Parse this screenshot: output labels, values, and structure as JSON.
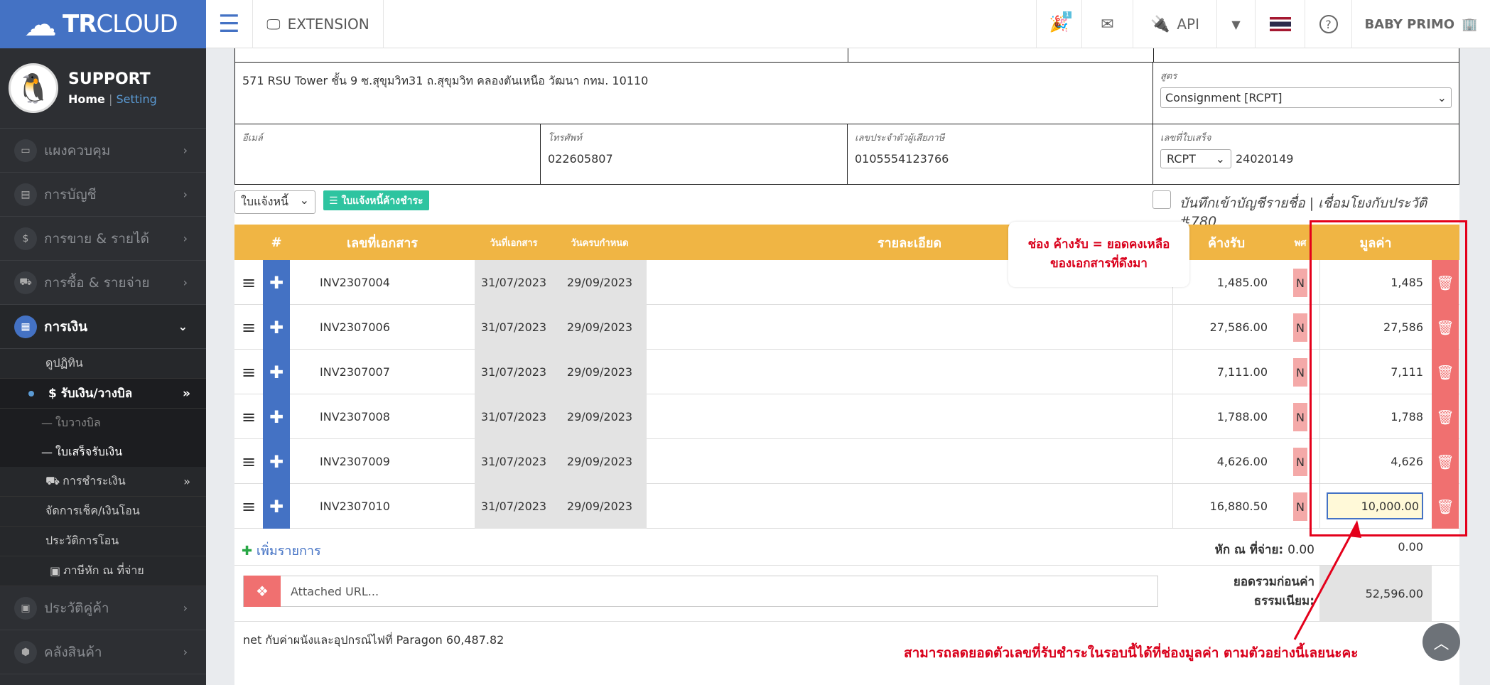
{
  "topbar": {
    "brand_bold": "TR",
    "brand_rest": "CLOUD",
    "extension": "EXTENSION",
    "api": "API",
    "badge": "1",
    "company": "BABY PRIMO"
  },
  "sidebar": {
    "profile_name": "SUPPORT",
    "home": "Home",
    "separator": "|",
    "setting": "Setting",
    "items": [
      {
        "label": "แผงควบคุม"
      },
      {
        "label": "การบัญชี"
      },
      {
        "label": "การขาย & รายได้"
      },
      {
        "label": "การซื้อ & รายจ่าย"
      },
      {
        "label": "การเงิน"
      },
      {
        "label": "ประวัติคู่ค้า"
      },
      {
        "label": "คลังสินค้า"
      }
    ],
    "finance_sub": {
      "cheque_in": "ดูปฏิทิน",
      "receive": "$ รับเงิน/วางบิล",
      "billing": "ใบวางบิล",
      "receipt": "ใบเสร็จรับเงิน",
      "payment": "การชำระเงิน",
      "cheque": "จัดการเช็ค/เงินโอน",
      "transfer_history": "ประวัติการโอน",
      "withholding": "ภาษีหัก ณ ที่จ่าย"
    }
  },
  "form": {
    "address": "571 RSU Tower ชั้น 9 ซ.สุขุมวิท31 ถ.สุขุมวิท คลองตันเหนือ วัฒนา กทม. 10110",
    "formula_label": "สูตร",
    "formula_value": "Consignment [RCPT]",
    "email_label": "อีเมล์",
    "email_value": "",
    "phone_label": "โทรศัพท์",
    "phone_value": "022605807",
    "tax_label": "เลขประจำตัวผู้เสียภาษี",
    "tax_value": "0105554123766",
    "receipt_label": "เลขที่ใบเสร็จ",
    "receipt_prefix": "RCPT",
    "receipt_number": "24020149",
    "doc_type_select": "ใบแจ้งหนี้",
    "outstanding_button": "ใบแจ้งหนี้ค้างชำระ",
    "record_text": "บันทึกเข้าบัญชีรายชื่อ | เชื่อมโยงกับประวัติ #780"
  },
  "table": {
    "headers": {
      "num": "#",
      "doc": "เลขที่เอกสาร",
      "doc_date": "วันที่เอกสาร",
      "due_date": "วันครบกำหนด",
      "detail": "รายละเอียด",
      "balance": "ค้างรับ",
      "wht": "พศ",
      "amount": "มูลค่า"
    },
    "rows": [
      {
        "doc": "INV2307004",
        "date": "31/07/2023",
        "due": "29/09/2023",
        "balance": "1,485.00",
        "flag": "N",
        "amount": "1,485"
      },
      {
        "doc": "INV2307006",
        "date": "31/07/2023",
        "due": "29/09/2023",
        "balance": "27,586.00",
        "flag": "N",
        "amount": "27,586"
      },
      {
        "doc": "INV2307007",
        "date": "31/07/2023",
        "due": "29/09/2023",
        "balance": "7,111.00",
        "flag": "N",
        "amount": "7,111"
      },
      {
        "doc": "INV2307008",
        "date": "31/07/2023",
        "due": "29/09/2023",
        "balance": "1,788.00",
        "flag": "N",
        "amount": "1,788"
      },
      {
        "doc": "INV2307009",
        "date": "31/07/2023",
        "due": "29/09/2023",
        "balance": "4,626.00",
        "flag": "N",
        "amount": "4,626"
      },
      {
        "doc": "INV2307010",
        "date": "31/07/2023",
        "due": "29/09/2023",
        "balance": "16,880.50",
        "flag": "N",
        "amount": "10,000.00"
      }
    ],
    "add_row": "เพิ่มรายการ",
    "withholding_label": "หัก ณ ที่จ่าย:",
    "withholding_value": "0.00",
    "withholding_amount": "0.00",
    "total_label_1": "ยอดรวมก่อนค่า",
    "total_label_2": "ธรรมเนียม:",
    "total_value": "52,596.00",
    "url_placeholder": "Attached URL...",
    "note": "net กับค่าผนังและอุปกรณ์ไฟที่ Paragon 60,487.82"
  },
  "annotations": {
    "callout_line1": "ช่อง ค้างรับ = ยอดคงเหลือ",
    "callout_line2": "ของเอกสารที่ดึงมา",
    "bottom_note": "สามารถลดยอดตัวเลขที่รับชำระในรอบนี้ได้ที่ช่องมูลค่า ตามตัวอย่างนี้เลยนะคะ",
    "color": "#e4001b"
  },
  "colors": {
    "brand": "#4472c4",
    "header": "#f0b544",
    "delete": "#f07070"
  }
}
